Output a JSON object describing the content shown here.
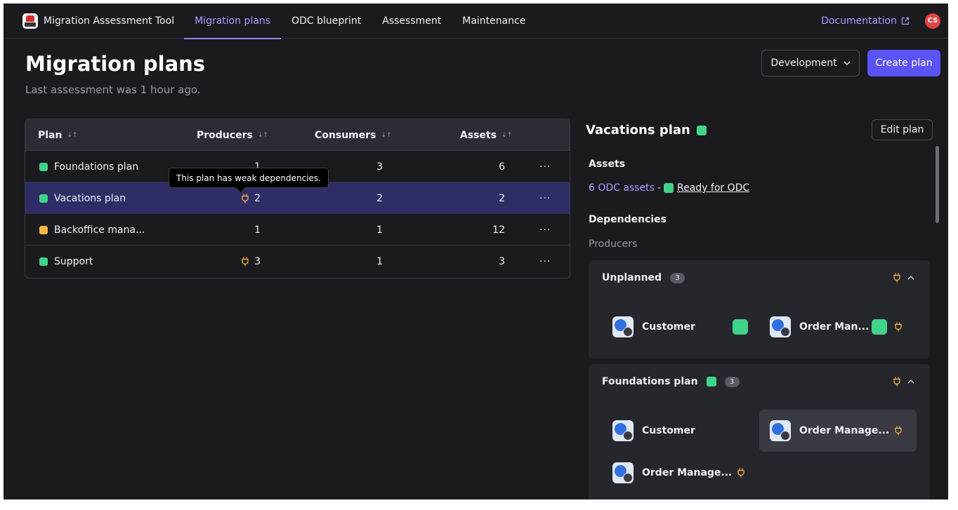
{
  "app": {
    "name": "Migration Assessment Tool"
  },
  "nav": {
    "tabs": [
      {
        "label": "Migration plans",
        "active": true
      },
      {
        "label": "ODC blueprint",
        "active": false
      },
      {
        "label": "Assessment",
        "active": false
      },
      {
        "label": "Maintenance",
        "active": false
      }
    ],
    "documentation": "Documentation",
    "avatar_initials": "CS"
  },
  "header": {
    "title": "Migration plans",
    "subtitle": "Last assessment was 1 hour ago.",
    "environment": "Development",
    "create_label": "Create plan"
  },
  "table": {
    "columns": [
      "Plan",
      "Producers",
      "Consumers",
      "Assets"
    ],
    "rows": [
      {
        "plan": "Foundations plan",
        "status": "green",
        "producers": "1",
        "weak": false,
        "consumers": "3",
        "assets": "6",
        "more": "···",
        "selected": false
      },
      {
        "plan": "Vacations plan",
        "status": "green",
        "producers": "2",
        "weak": true,
        "consumers": "2",
        "assets": "2",
        "more": "···",
        "selected": true
      },
      {
        "plan": "Backoffice mana...",
        "status": "orange",
        "producers": "1",
        "weak": false,
        "consumers": "1",
        "assets": "12",
        "more": "···",
        "selected": false
      },
      {
        "plan": "Support",
        "status": "green",
        "producers": "3",
        "weak": true,
        "consumers": "1",
        "assets": "3",
        "more": "···",
        "selected": false
      }
    ],
    "tooltip": "This plan has weak dependencies."
  },
  "detail": {
    "title": "Vacations plan",
    "edit_label": "Edit plan",
    "assets_label": "Assets",
    "assets_count": "6 ODC assets",
    "assets_sep": "-",
    "assets_status": "Ready for ODC",
    "dependencies_label": "Dependencies",
    "producers_label": "Producers",
    "groups": [
      {
        "name": "Unplanned",
        "count": "3",
        "items": [
          {
            "label": "Customer",
            "status": "green",
            "weak": false
          },
          {
            "label": "Order Man...",
            "status": "green",
            "weak": true
          }
        ]
      },
      {
        "name": "Foundations plan",
        "status": "green",
        "count": "3",
        "items": [
          {
            "label": "Customer",
            "weak": false
          },
          {
            "label": "Order Manage...",
            "weak": true
          },
          {
            "label": "Order Manage...",
            "weak": true
          }
        ]
      }
    ]
  },
  "colors": {
    "accent": "#5b54f4",
    "link": "#a7a0ff",
    "ready": "#41d389",
    "warning": "#f4b740",
    "background": "#1a1a1f"
  }
}
